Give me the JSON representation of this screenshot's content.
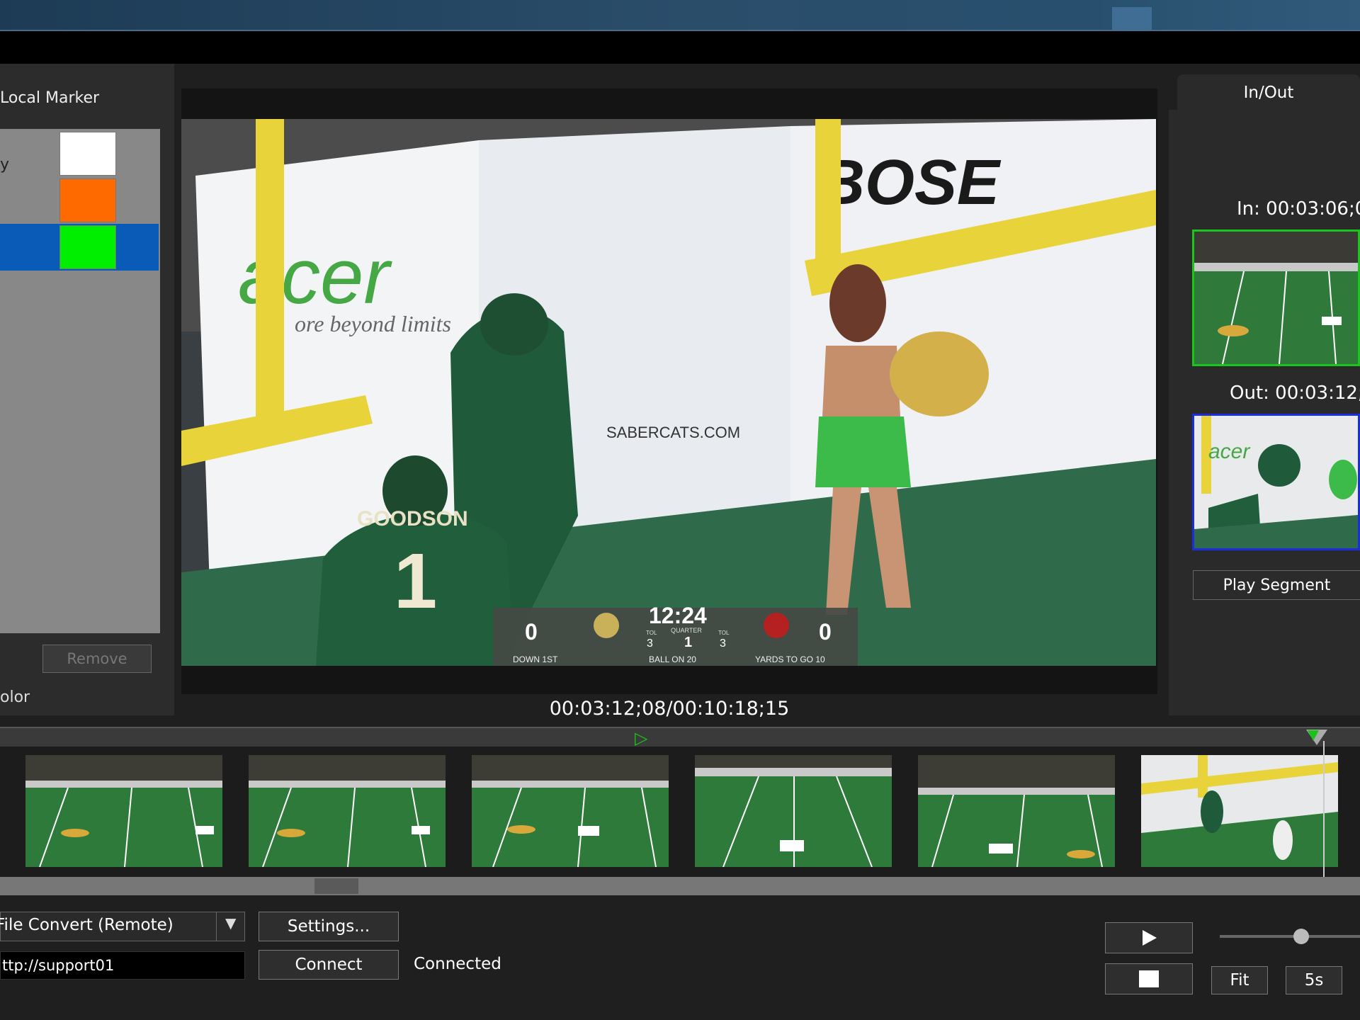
{
  "window": {
    "title": ""
  },
  "left_panel": {
    "title": "Local Marker",
    "rows": [
      {
        "label": "y",
        "color": "#ffffff"
      },
      {
        "label": "",
        "color": "#ff6a00"
      },
      {
        "label": "",
        "color": "#00ee00",
        "selected": true
      }
    ],
    "remove_label": "Remove",
    "color_label": "olor"
  },
  "video": {
    "timecode": "00:03:12;08/00:10:18;15",
    "scoreboard": {
      "home_score": "0",
      "away_score": "0",
      "clock": "12:24",
      "quarter_label": "QUARTER",
      "quarter": "1",
      "tol_label": "TOL",
      "home_tol": "3",
      "away_tol": "3",
      "down": "DOWN 1ST",
      "ball_on": "BALL ON 20",
      "yards_to_go": "YARDS TO GO 10"
    },
    "jersey_name": "GOODSON",
    "jersey_number": "1",
    "banner_acer": "acer",
    "banner_tagline": "ore beyond limits",
    "banner_bose": "BOSE",
    "banner_sabercats": "SABERCATS.COM"
  },
  "right_panel": {
    "tab_label": "In/Out",
    "in_label": "In: 00:03:06;0",
    "out_label": "Out: 00:03:12;",
    "play_segment_label": "Play Segment",
    "in_border_color": "#1ac61a",
    "out_border_color": "#1a2ee0"
  },
  "timeline": {
    "frames": [
      "frame-1",
      "frame-2",
      "frame-3",
      "frame-4",
      "frame-5",
      "frame-6"
    ]
  },
  "bottom": {
    "convert_mode": "File Convert (Remote)",
    "settings_label": "Settings...",
    "url_value": "ttp://support01",
    "connect_label": "Connect",
    "status": "Connected",
    "fit_label": "Fit",
    "step_label": "5s"
  }
}
